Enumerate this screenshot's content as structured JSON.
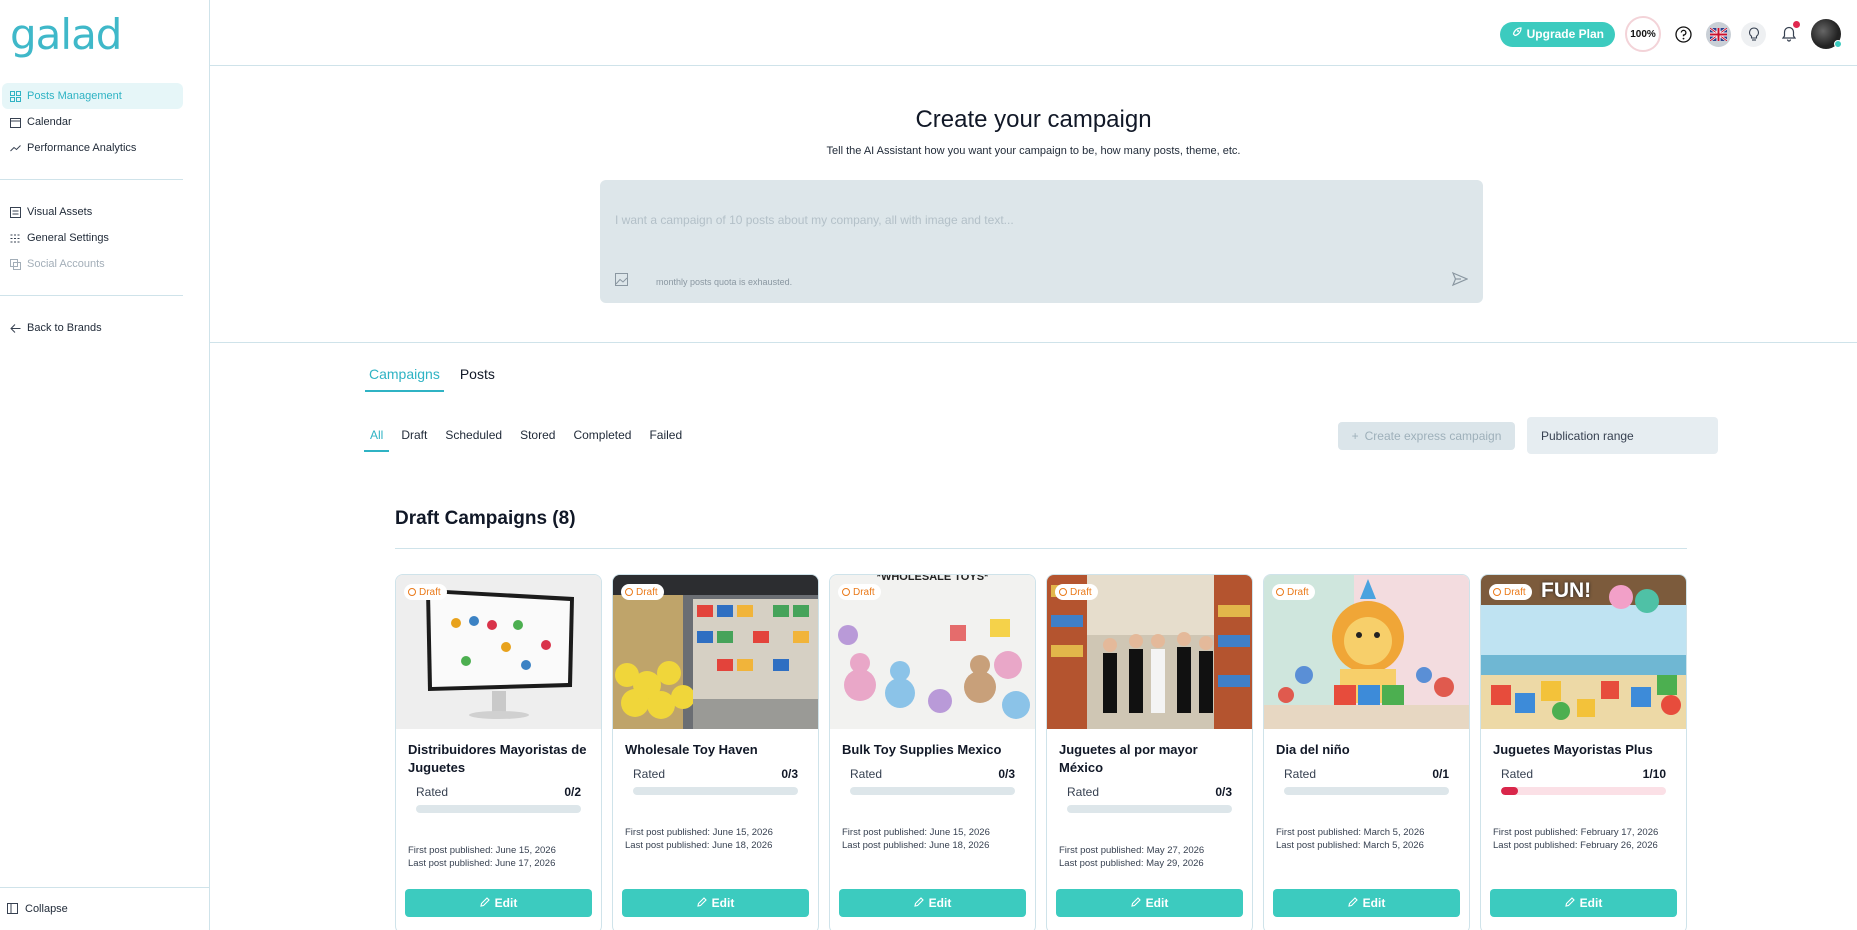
{
  "brand": {
    "logo_text": "galad",
    "accent": "#3fb8c9"
  },
  "sidebar": {
    "primary": [
      {
        "label": "Posts Management",
        "icon": "grid-icon",
        "active": true
      },
      {
        "label": "Calendar",
        "icon": "calendar-icon"
      },
      {
        "label": "Performance Analytics",
        "icon": "trend-icon"
      }
    ],
    "secondary": [
      {
        "label": "Visual Assets",
        "icon": "images-icon"
      },
      {
        "label": "General Settings",
        "icon": "sliders-icon"
      },
      {
        "label": "Social Accounts",
        "icon": "share-icon",
        "disabled": true
      }
    ],
    "back": {
      "label": "Back to Brands",
      "icon": "arrow-left-icon"
    },
    "collapse": {
      "label": "Collapse",
      "icon": "collapse-icon"
    }
  },
  "topbar": {
    "upgrade_label": "Upgrade Plan",
    "usage_percent": "100%",
    "icons": [
      "help-icon",
      "flag-uk-icon",
      "bulb-icon",
      "bell-icon",
      "avatar"
    ]
  },
  "hero": {
    "title": "Create your campaign",
    "subtitle": "Tell the AI Assistant how you want your campaign to be, how many posts, theme, etc.",
    "placeholder": "I want a campaign of 10 posts about my company, all with image and text...",
    "quota_message": "monthly posts quota is exhausted."
  },
  "tabs": [
    {
      "label": "Campaigns",
      "active": true
    },
    {
      "label": "Posts"
    }
  ],
  "filters": [
    {
      "label": "All",
      "active": true
    },
    {
      "label": "Draft"
    },
    {
      "label": "Scheduled"
    },
    {
      "label": "Stored"
    },
    {
      "label": "Completed"
    },
    {
      "label": "Failed"
    }
  ],
  "express_label": "Create express campaign",
  "range_label": "Publication range",
  "section_title": "Draft Campaigns (8)",
  "rated_label": "Rated",
  "edit_label": "Edit",
  "status_label": "Draft",
  "cards": [
    {
      "title": "Distribuidores Mayoristas de Juguetes",
      "rated": "0/2",
      "rated_fraction": 0,
      "first": "First post published: June 15, 2026",
      "last": "Last post published: June 17, 2026",
      "thumb": "monitor"
    },
    {
      "title": "Wholesale Toy Haven",
      "rated": "0/3",
      "rated_fraction": 0,
      "first": "First post published: June 15, 2026",
      "last": "Last post published: June 18, 2026",
      "thumb": "store"
    },
    {
      "title": "Bulk Toy Supplies Mexico",
      "rated": "0/3",
      "rated_fraction": 0,
      "first": "First post published: June 15, 2026",
      "last": "Last post published: June 18, 2026",
      "thumb": "plush",
      "caption": "*WHOLESALE TOYS*"
    },
    {
      "title": "Juguetes al por mayor México",
      "rated": "0/3",
      "rated_fraction": 0,
      "first": "First post published: May 27, 2026",
      "last": "Last post published: May 29, 2026",
      "thumb": "people"
    },
    {
      "title": "Dia del niño",
      "rated": "0/1",
      "rated_fraction": 0,
      "first": "First post published: March 5, 2026",
      "last": "Last post published: March 5, 2026",
      "thumb": "lion"
    },
    {
      "title": "Juguetes Mayoristas Plus",
      "rated": "1/10",
      "rated_fraction": 0.1,
      "first": "First post published: February 17, 2026",
      "last": "Last post published: February 26, 2026",
      "thumb": "beach",
      "caption": "FUN!"
    }
  ]
}
